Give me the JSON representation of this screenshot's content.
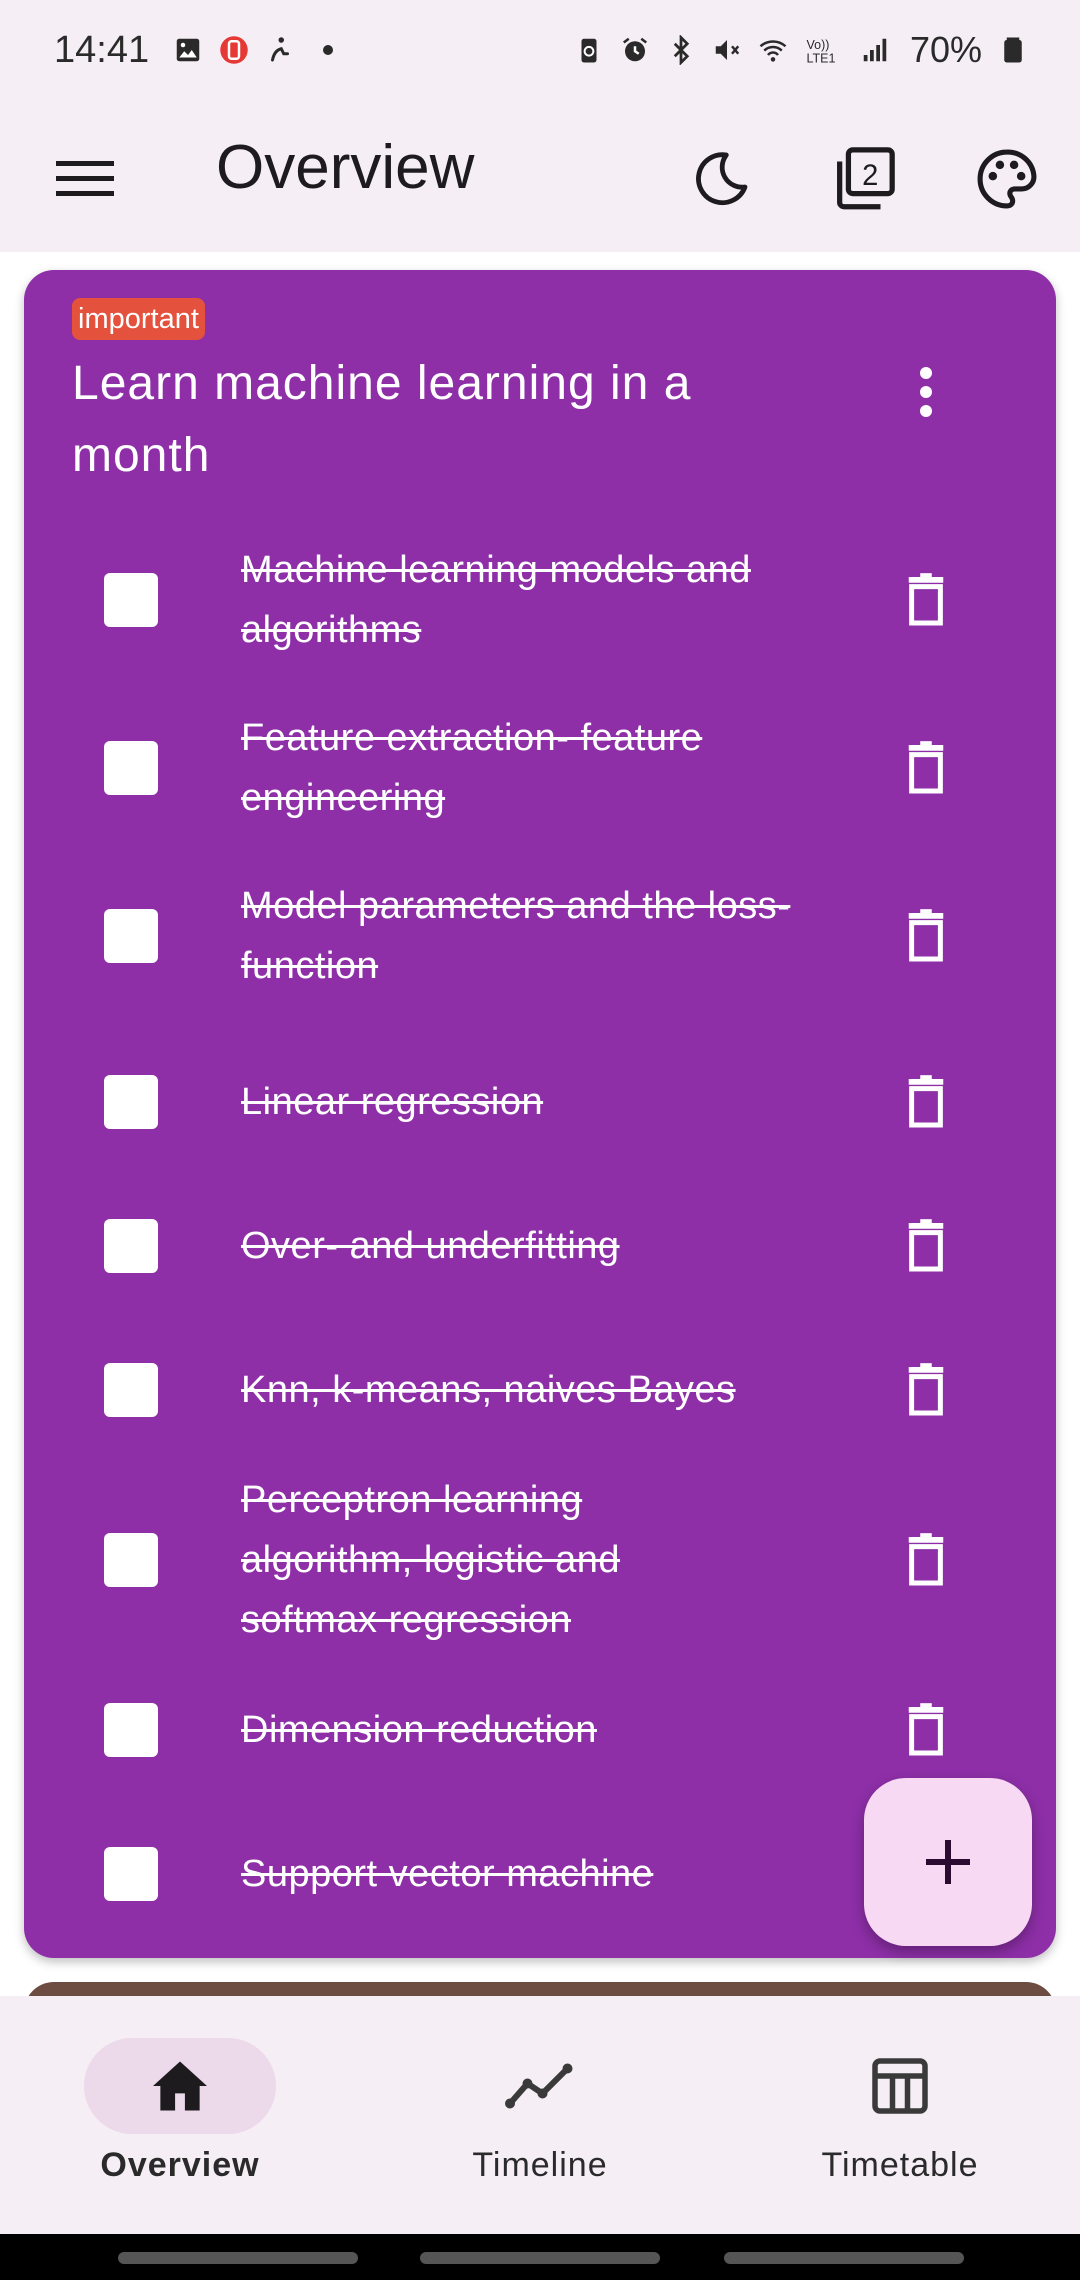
{
  "status_bar": {
    "time": "14:41",
    "left_icons": [
      "gallery-icon",
      "app-notification-icon",
      "accessibility-icon"
    ],
    "right_icons": [
      "battery-saver-icon",
      "alarm-icon",
      "bluetooth-icon",
      "mute-icon",
      "wifi-icon",
      "volte-icon",
      "signal-icon"
    ],
    "volte_text": "Vo)) LTE1",
    "battery_percent": "70%"
  },
  "app_bar": {
    "title": "Overview",
    "menu_icon": "hamburger-menu-icon",
    "actions": [
      "dark-mode-icon",
      "filter-stack-icon",
      "palette-icon"
    ],
    "stack_badge": "2"
  },
  "card": {
    "color": "#8e2fa8",
    "tag": "important",
    "tag_color": "#e4513c",
    "title": "Learn machine learning in a month",
    "tasks": [
      {
        "label": "Machine learning models and algorithms",
        "done": true
      },
      {
        "label": "Feature extraction- feature engineering",
        "done": true
      },
      {
        "label": "Model parameters and the loss-function",
        "done": true
      },
      {
        "label": "Linear regression",
        "done": true
      },
      {
        "label": "Over- and underfitting",
        "done": true
      },
      {
        "label": "Knn, k-means, naives Bayes",
        "done": true
      },
      {
        "label": "Perceptron learning algorithm, logistic and softmax regression",
        "done": true
      },
      {
        "label": "Dimension reduction",
        "done": true
      },
      {
        "label": "Support vector machine",
        "done": true
      }
    ]
  },
  "next_card_color": "#6d4c41",
  "fab": {
    "icon": "add-icon",
    "color": "#f7d9f3"
  },
  "bottom_nav": {
    "items": [
      {
        "label": "Overview",
        "icon": "home-icon",
        "active": true
      },
      {
        "label": "Timeline",
        "icon": "timeline-icon",
        "active": false
      },
      {
        "label": "Timetable",
        "icon": "table-icon",
        "active": false
      }
    ]
  }
}
